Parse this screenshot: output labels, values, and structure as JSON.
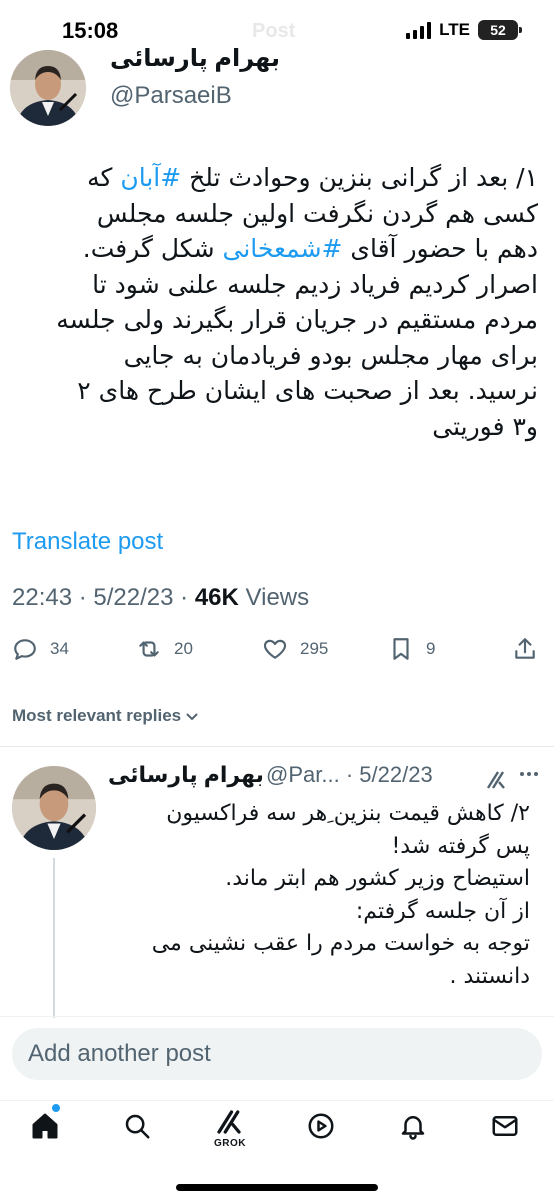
{
  "status": {
    "time": "15:08",
    "network": "LTE",
    "battery": "52"
  },
  "header": {
    "title": "Post"
  },
  "author": {
    "name": "بهرام پارسائی",
    "handle": "@ParsaeiB"
  },
  "tweet": {
    "lines": [
      {
        "before": "۱/ بعد از گرانی بنزین وحوادث تلخ ",
        "hashtag": "#آبان",
        "after": " که"
      },
      {
        "before": "کسی هم گردن نگرفت اولین جلسه مجلس",
        "hashtag": "",
        "after": ""
      },
      {
        "before": "دهم با حضور آقای ",
        "hashtag": "#شمعخانی",
        "after": " شکل گرفت."
      },
      {
        "before": "اصرار کردیم فریاد زدیم جلسه علنی شود تا",
        "hashtag": "",
        "after": ""
      },
      {
        "before": "مردم مستقیم در جریان قرار بگیرند ولی جلسه",
        "hashtag": "",
        "after": ""
      },
      {
        "before": "برای مهار مجلس بودو فریادمان به جایی",
        "hashtag": "",
        "after": ""
      },
      {
        "before": "نرسید. بعد از صحبت های ایشان طرح های ۲",
        "hashtag": "",
        "after": ""
      },
      {
        "before": "و۳ فوریتی",
        "hashtag": "",
        "after": ""
      }
    ],
    "translate_label": "Translate post",
    "time": "22:43",
    "date": "5/22/23",
    "views_count": "46K",
    "views_label": "Views",
    "separator": "·"
  },
  "actions": {
    "replies": "34",
    "reposts": "20",
    "likes": "295",
    "bookmarks": "9"
  },
  "replies_sort": {
    "label": "Most relevant replies"
  },
  "reply": {
    "name": "بهرام پارسائی",
    "handle": "@Par...",
    "date": "5/22/23",
    "separator": "·",
    "lines": [
      "۲/ کاهش قیمت بنزین ِهر سه فراکسیون",
      "پس گرفته شد!",
      "استیضاح وزیر کشور هم ابتر ماند.",
      "از آن جلسه گرفتم:",
      "توجه به خواست مردم را عقب نشینی می",
      "دانستند ."
    ]
  },
  "compose": {
    "placeholder": "Add another post"
  },
  "nav": {
    "grok_label": "GROK"
  }
}
